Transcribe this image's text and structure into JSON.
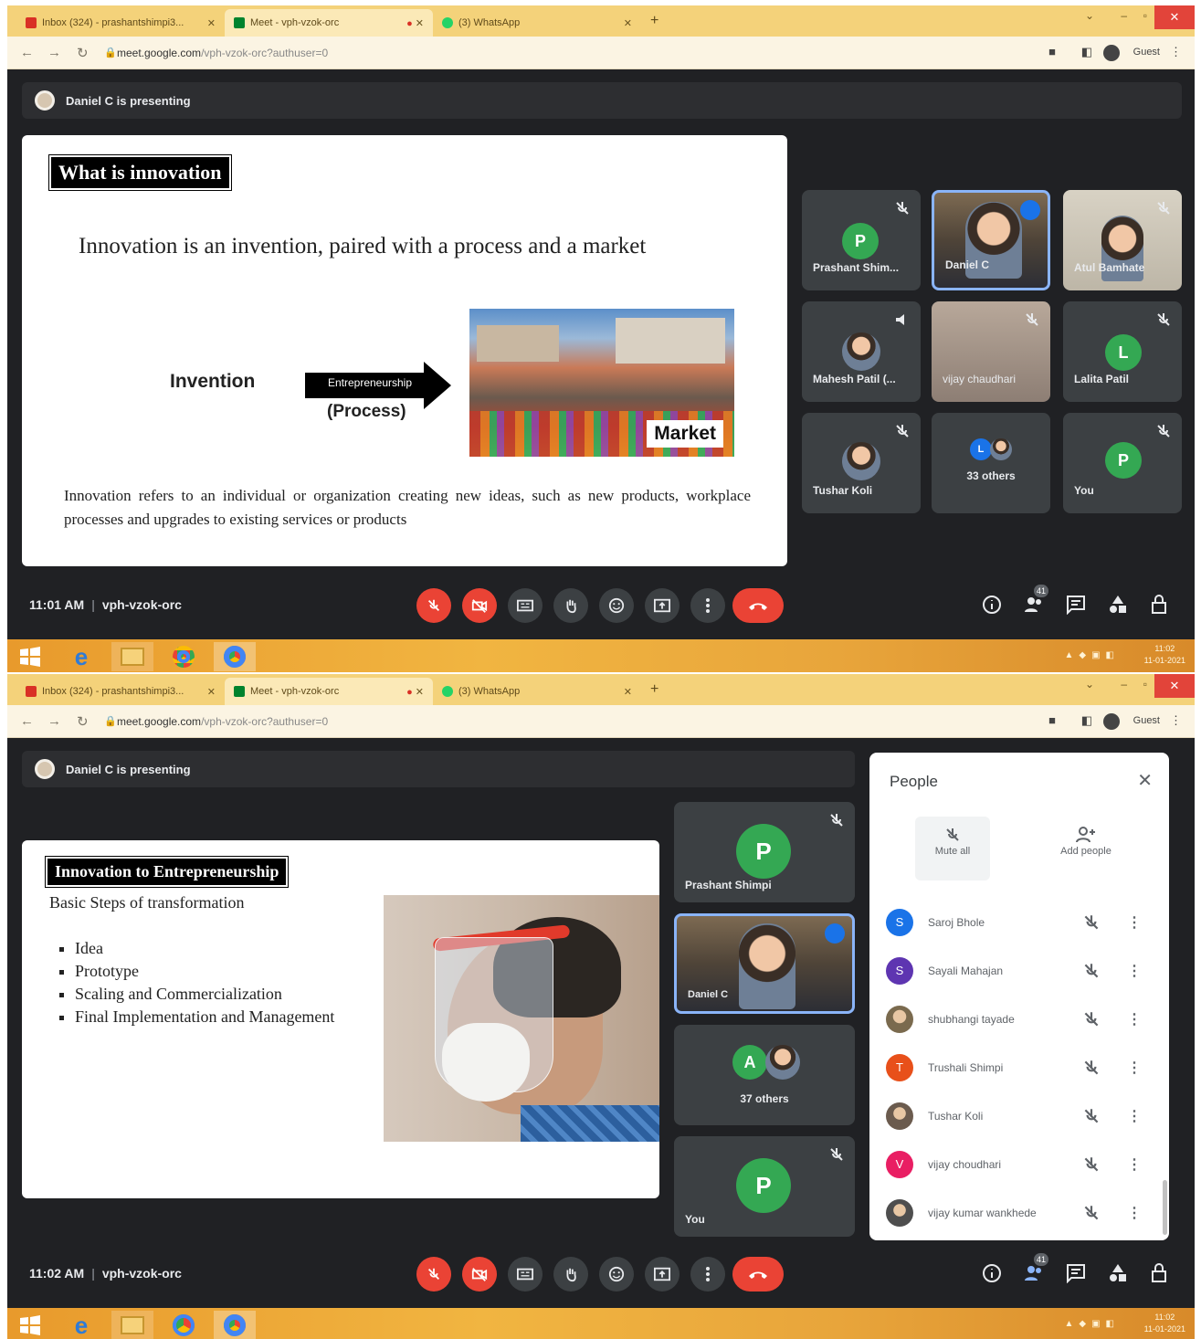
{
  "browser": {
    "tabs": [
      {
        "label": "Inbox (324) - prashantshimpi3...",
        "icon": "gmail-icon",
        "color": "#d93025"
      },
      {
        "label": "Meet - vph-vzok-orc",
        "icon": "meet-icon",
        "color": "#00832d"
      },
      {
        "label": "(3) WhatsApp",
        "icon": "whatsapp-icon",
        "color": "#25d366"
      }
    ],
    "new_tab": "+",
    "url_host": "meet.google.com",
    "url_path": "/vph-vzok-orc?authuser=0",
    "profile_label": "Guest"
  },
  "shot1": {
    "presenting": "Daniel C is presenting",
    "slide": {
      "title": "What is innovation",
      "tagline": "Innovation is an invention, paired with a process and a market",
      "invention": "Invention",
      "arrow_label": "Entrepreneurship",
      "process": "(Process)",
      "market": "Market",
      "description": "Innovation refers to an individual or organization creating new ideas, such as new products, workplace processes and upgrades to existing services or products"
    },
    "tiles": [
      {
        "name": "Prashant Shim...",
        "letter": "P",
        "color": "#34a853"
      },
      {
        "name": "Daniel C"
      },
      {
        "name": "Atul Bamhate"
      },
      {
        "name": "Mahesh Patil (..."
      },
      {
        "name": "vijay chaudhari"
      },
      {
        "name": "Lalita Patil",
        "letter": "L",
        "color": "#34a853"
      },
      {
        "name": "Tushar Koli"
      },
      {
        "name": "33 others",
        "letter": "L",
        "color": "#1a73e8"
      },
      {
        "name": "You",
        "letter": "P",
        "color": "#34a853"
      }
    ],
    "time": "11:01 AM",
    "meeting_code": "vph-vzok-orc",
    "people_count": "41"
  },
  "shot2": {
    "presenting": "Daniel C is presenting",
    "slide": {
      "title": "Innovation to Entrepreneurship",
      "subtitle": "Basic Steps of transformation",
      "bullets": [
        "Idea",
        "Prototype",
        "Scaling and Commercialization",
        "Final Implementation and Management"
      ]
    },
    "tiles": [
      {
        "name": "Prashant Shimpi",
        "letter": "P",
        "color": "#34a853"
      },
      {
        "name": "Daniel C"
      },
      {
        "name": "37 others",
        "letter": "A",
        "color": "#34a853"
      },
      {
        "name": "You",
        "letter": "P",
        "color": "#34a853"
      }
    ],
    "people_panel": {
      "title": "People",
      "mute_all": "Mute all",
      "add_people": "Add people",
      "participants": [
        {
          "name": "Saroj Bhole",
          "letter": "S",
          "color": "#1a73e8"
        },
        {
          "name": "Sayali Mahajan",
          "letter": "S",
          "color": "#5e35b1"
        },
        {
          "name": "shubhangi tayade",
          "letter": "",
          "color": "#7a6a4e"
        },
        {
          "name": "Trushali Shimpi",
          "letter": "T",
          "color": "#e8501a"
        },
        {
          "name": "Tushar Koli",
          "letter": "",
          "color": "#6b5b4e"
        },
        {
          "name": "vijay choudhari",
          "letter": "V",
          "color": "#e91e63"
        },
        {
          "name": "vijay kumar wankhede",
          "letter": "",
          "color": "#4e4e4e"
        }
      ]
    },
    "time": "11:02 AM",
    "meeting_code": "vph-vzok-orc",
    "people_count": "41"
  },
  "taskbar": {
    "clock_time": "11:02",
    "clock_date": "11-01-2021"
  },
  "colors": {
    "meet_bg": "#202124",
    "tile_bg": "#3c4043",
    "end_call": "#ea4335",
    "accent_blue": "#8ab4f8"
  }
}
